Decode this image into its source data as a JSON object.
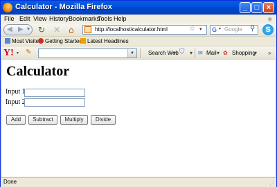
{
  "window": {
    "title": "Calculator - Mozilla Firefox"
  },
  "menu": [
    "File",
    "Edit",
    "View",
    "History",
    "Bookmarks",
    "Tools",
    "Help"
  ],
  "nav": {
    "url": "http://localhost/calculator.html",
    "search_placeholder": "Google",
    "search_engine_letter": "G"
  },
  "bookmarks": [
    "Most Visited",
    "Getting Started",
    "Latest Headlines"
  ],
  "yahoo_toolbar": {
    "logo": "Y!",
    "search_web": "Search Web",
    "mail": "Mail",
    "shopping": "Shopping"
  },
  "page": {
    "heading": "Calculator",
    "input1_label": "Input 1:",
    "input2_label": "Input 2:",
    "buttons": [
      "Add",
      "Subtract",
      "Multiply",
      "Divide"
    ]
  },
  "status": "Done",
  "colors": {
    "titlebar": "#0050e0",
    "accent_red": "#d0021b"
  },
  "icons": [
    "firefox-icon",
    "back-icon",
    "forward-icon",
    "reload-icon",
    "stop-icon",
    "home-icon",
    "bookmark-star-icon",
    "search-icon",
    "skype-icon"
  ]
}
